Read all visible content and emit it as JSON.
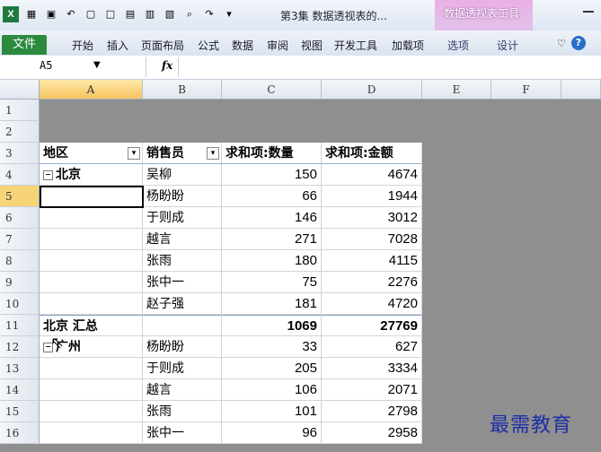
{
  "window": {
    "title": "第3集 数据透视表的...",
    "pivot_tools_label": "数据透视表工具"
  },
  "ribbon": {
    "file_tab": "文件",
    "tabs": [
      "开始",
      "插入",
      "页面布局",
      "公式",
      "数据",
      "审阅",
      "视图",
      "开发工具",
      "加载项"
    ],
    "context_tabs": [
      "选项",
      "设计"
    ]
  },
  "formula_bar": {
    "name_box": "A5",
    "fx": "fx",
    "value": ""
  },
  "columns": [
    "A",
    "B",
    "C",
    "D",
    "E",
    "F"
  ],
  "rows": [
    "1",
    "2",
    "3",
    "4",
    "5",
    "6",
    "7",
    "8",
    "9",
    "10",
    "11",
    "12",
    "13",
    "14",
    "15",
    "16"
  ],
  "pivot": {
    "headers": [
      "地区",
      "销售员",
      "求和项:数量",
      "求和项:金额"
    ],
    "data": [
      {
        "region": "北京",
        "person": "吴柳",
        "qty": "150",
        "amt": "4674"
      },
      {
        "region": "",
        "person": "杨盼盼",
        "qty": "66",
        "amt": "1944"
      },
      {
        "region": "",
        "person": "于则成",
        "qty": "146",
        "amt": "3012"
      },
      {
        "region": "",
        "person": "越言",
        "qty": "271",
        "amt": "7028"
      },
      {
        "region": "",
        "person": "张雨",
        "qty": "180",
        "amt": "4115"
      },
      {
        "region": "",
        "person": "张中一",
        "qty": "75",
        "amt": "2276"
      },
      {
        "region": "",
        "person": "赵子强",
        "qty": "181",
        "amt": "4720"
      },
      {
        "region": "北京 汇总",
        "person": "",
        "qty": "1069",
        "amt": "27769"
      },
      {
        "region": "广州",
        "person": "杨盼盼",
        "qty": "33",
        "amt": "627"
      },
      {
        "region": "",
        "person": "于则成",
        "qty": "205",
        "amt": "3334"
      },
      {
        "region": "",
        "person": "越言",
        "qty": "106",
        "amt": "2071"
      },
      {
        "region": "",
        "person": "张雨",
        "qty": "101",
        "amt": "2798"
      },
      {
        "region": "",
        "person": "张中一",
        "qty": "96",
        "amt": "2958"
      }
    ]
  },
  "watermark": "最需教育",
  "colors": {
    "file_tab": "#2b8a3e",
    "pivot_context": "#e2a8e0",
    "selected_header": "#f6c35e",
    "grid_background": "#8f8f8f"
  }
}
